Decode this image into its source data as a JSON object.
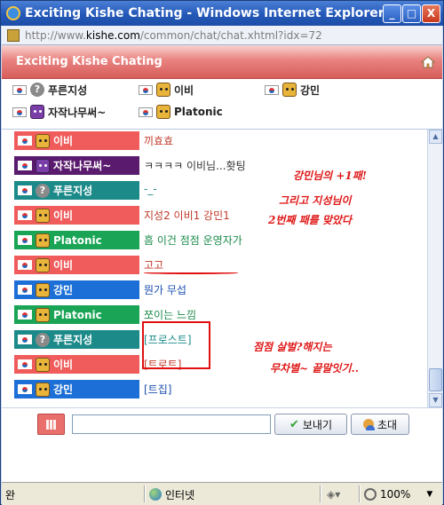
{
  "window": {
    "title": "Exciting Kishe Chating - Windows Internet Explorer",
    "url_prefix": "http://www.",
    "url_host": "kishe.com",
    "url_path": "/common/chat/chat.xhtml?idx=72",
    "min_label": "_",
    "max_label": "□",
    "close_label": "X"
  },
  "app": {
    "title": "Exciting Kishe Chating"
  },
  "users": [
    {
      "name": "푸른지성",
      "avatar": "question-avatar"
    },
    {
      "name": "이비",
      "avatar": "tiger-avatar"
    },
    {
      "name": "강민",
      "avatar": "tiger-avatar"
    },
    {
      "name": "자작나무써~",
      "avatar": "cat-avatar"
    },
    {
      "name": "Platonic",
      "avatar": "tiger-avatar"
    }
  ],
  "messages": [
    {
      "user": "이비",
      "text": "끼효효",
      "chip_color": "#f05c5c",
      "text_color": "#c0392b"
    },
    {
      "user": "자작나무써~",
      "text": "ㅋㅋㅋㅋ 이비님...홧팅",
      "chip_color": "#5a1a6e",
      "text_color": "#333333"
    },
    {
      "user": "푸른지성",
      "text": "-_-",
      "chip_color": "#1d8a8a",
      "text_color": "#1d8a8a"
    },
    {
      "user": "이비",
      "text": "지성2 이비1 강민1",
      "chip_color": "#f05c5c",
      "text_color": "#c0392b"
    },
    {
      "user": "Platonic",
      "text": "흠 이건 점점 운영자가",
      "chip_color": "#1aa556",
      "text_color": "#1a8a4a"
    },
    {
      "user": "이비",
      "text": "고고",
      "chip_color": "#f05c5c",
      "text_color": "#c0392b"
    },
    {
      "user": "강민",
      "text": "뭔가 무섭",
      "chip_color": "#1c6fd6",
      "text_color": "#1c4fb0"
    },
    {
      "user": "Platonic",
      "text": "쪼이는 느낌",
      "chip_color": "#1aa556",
      "text_color": "#1a8a4a"
    },
    {
      "user": "푸른지성",
      "text": "[프로스트]",
      "chip_color": "#1d8a8a",
      "text_color": "#1d8a8a"
    },
    {
      "user": "이비",
      "text": "[트로트]",
      "chip_color": "#f05c5c",
      "text_color": "#c0392b"
    },
    {
      "user": "강민",
      "text": "[트집]",
      "chip_color": "#1c6fd6",
      "text_color": "#1c4fb0"
    }
  ],
  "annotations": {
    "note1": "강민님의 +1패!",
    "note2": "그리고 지성님이",
    "note3": "2번째 패를 맞았다",
    "note4": "점점 살벌?해지는",
    "note5": "무차별~ 끝말잇기.."
  },
  "input": {
    "value": "",
    "send_label": "보내기",
    "invite_label": "초대"
  },
  "statusbar": {
    "status": "완",
    "zone": "인터넷",
    "zoom": "100%"
  }
}
